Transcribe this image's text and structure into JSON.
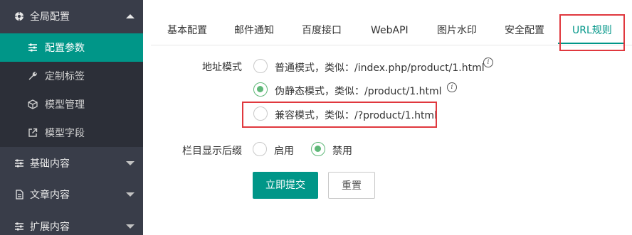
{
  "sidebar": {
    "groups": [
      {
        "label": "全局配置",
        "icon": "gear-icon",
        "expanded": true
      },
      {
        "label": "基础内容",
        "icon": "sliders-icon",
        "expanded": false
      },
      {
        "label": "文章内容",
        "icon": "document-icon",
        "expanded": false
      },
      {
        "label": "扩展内容",
        "icon": "sliders-icon",
        "expanded": false
      }
    ],
    "sub_items": [
      {
        "label": "配置参数",
        "icon": "sliders-icon",
        "active": true
      },
      {
        "label": "定制标签",
        "icon": "wrench-icon",
        "active": false
      },
      {
        "label": "模型管理",
        "icon": "cube-icon",
        "active": false
      },
      {
        "label": "模型字段",
        "icon": "external-link-icon",
        "active": false
      }
    ]
  },
  "tabs": [
    {
      "label": "基本配置"
    },
    {
      "label": "邮件通知"
    },
    {
      "label": "百度接口"
    },
    {
      "label": "WebAPI"
    },
    {
      "label": "图片水印"
    },
    {
      "label": "安全配置"
    },
    {
      "label": "URL规则",
      "active": true
    }
  ],
  "form": {
    "url_mode": {
      "label": "地址模式",
      "options": [
        {
          "text": "普通模式，类似：/index.php/product/1.html",
          "checked": false,
          "info": true
        },
        {
          "text": "伪静态模式，类似：/product/1.html",
          "checked": true,
          "info": true
        },
        {
          "text": "兼容模式，类似：/?product/1.html",
          "checked": false,
          "info": false
        }
      ]
    },
    "suffix": {
      "label": "栏目显示后缀",
      "options": [
        {
          "text": "启用",
          "checked": false
        },
        {
          "text": "禁用",
          "checked": true
        }
      ]
    },
    "submit_label": "立即提交",
    "reset_label": "重置"
  },
  "colors": {
    "accent": "#009688",
    "radio_checked": "#5fb878",
    "sidebar_bg": "#393d49",
    "highlight_box": "#e0383e"
  }
}
